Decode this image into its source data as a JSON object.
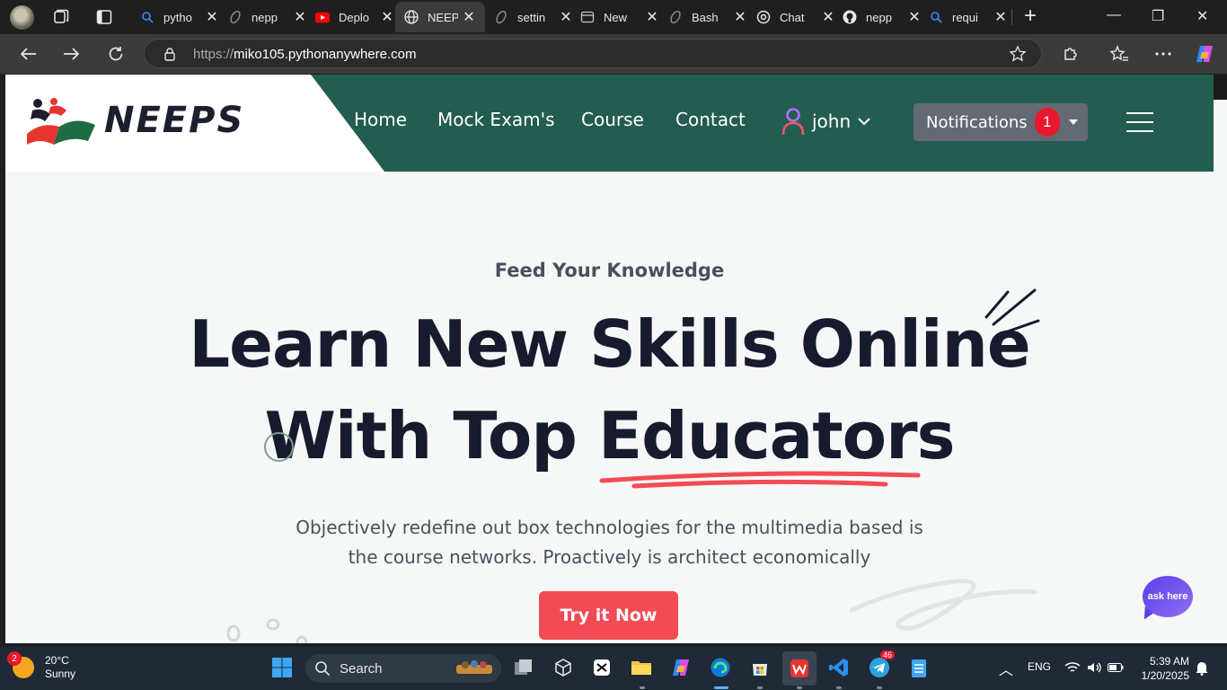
{
  "browser": {
    "tabs": [
      {
        "title": "pytho",
        "icon": "search-icon"
      },
      {
        "title": "nepp",
        "icon": "swirl-icon"
      },
      {
        "title": "Deplo",
        "icon": "youtube-icon"
      },
      {
        "title": "NEEP",
        "icon": "globe-icon",
        "active": true
      },
      {
        "title": "settin",
        "icon": "swirl-icon"
      },
      {
        "title": "New",
        "icon": "newtab-icon"
      },
      {
        "title": "Bash",
        "icon": "swirl-icon"
      },
      {
        "title": "Chat",
        "icon": "openai-icon"
      },
      {
        "title": "nepp",
        "icon": "github-icon"
      },
      {
        "title": "requi",
        "icon": "search-icon"
      }
    ],
    "url_protocol": "https://",
    "url_host": "miko105.pythonanywhere.com"
  },
  "site": {
    "logo_text": "NEEPS",
    "nav": [
      "Home",
      "Mock Exam's",
      "Course",
      "Contact"
    ],
    "user_name": "john",
    "notifications_label": "Notifications",
    "notifications_count": "1",
    "colors": {
      "header": "#235c50",
      "accent": "#f34b55",
      "heading": "#171b2e"
    }
  },
  "hero": {
    "eyebrow": "Feed Your Knowledge",
    "line1": "Learn New Skills Online",
    "line2": "With Top Educators",
    "description_line1": "Objectively redefine out box technologies for the multimedia based is",
    "description_line2": "the course networks. Proactively is architect economically",
    "cta": "Try it Now",
    "chat_label": "ask here"
  },
  "taskbar": {
    "weather_badge": "2",
    "temperature": "20°C",
    "condition": "Sunny",
    "search_label": "Search",
    "telegram_badge": "46",
    "language": "ENG",
    "time": "5:39 AM",
    "date": "1/20/2025"
  }
}
